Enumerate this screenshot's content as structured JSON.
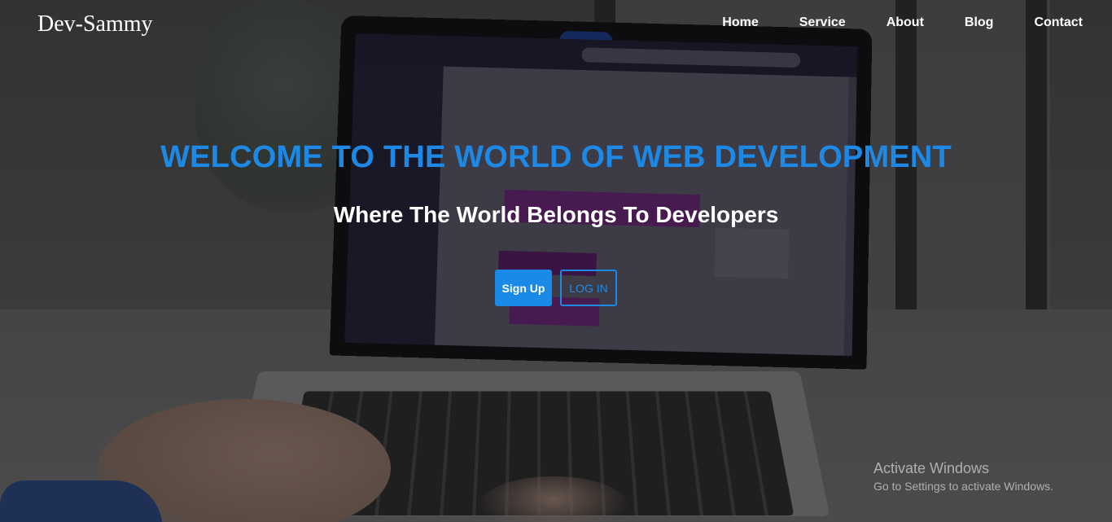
{
  "brand": {
    "name": "Dev-Sammy"
  },
  "nav": {
    "items": [
      {
        "label": "Home"
      },
      {
        "label": "Service"
      },
      {
        "label": "About"
      },
      {
        "label": "Blog"
      },
      {
        "label": "Contact"
      }
    ]
  },
  "hero": {
    "title": "WELCOME TO THE WORLD OF WEB DEVELOPMENT",
    "subtitle": "Where The World Belongs To Developers",
    "signup_label": "Sign Up",
    "login_label": "LOG IN"
  },
  "watermark": {
    "title": "Activate Windows",
    "subtitle": "Go to Settings to activate Windows."
  },
  "colors": {
    "accent": "#1e88e5",
    "signup_bg": "#1a8ae6",
    "text": "#ffffff"
  }
}
